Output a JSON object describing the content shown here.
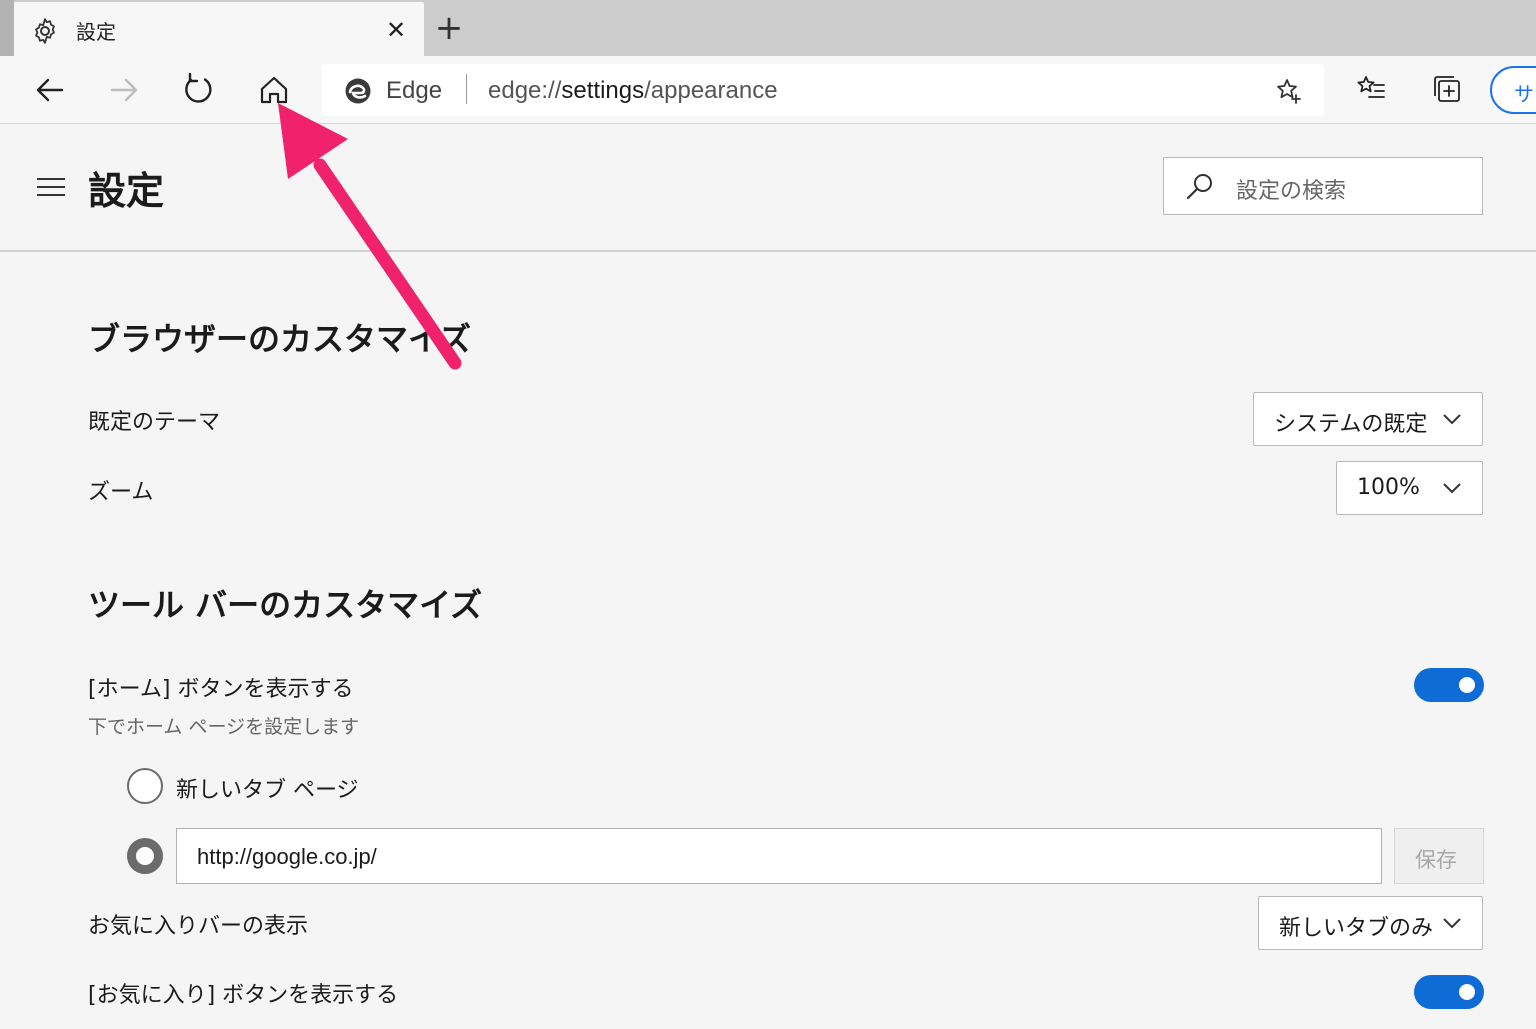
{
  "tab": {
    "title": "設定",
    "close": "✕",
    "new_tab": "+"
  },
  "address_bar": {
    "brand": "Edge",
    "url_scheme": "edge://",
    "url_host": "settings",
    "url_path": "/appearance"
  },
  "profile": {
    "label": "サ"
  },
  "settings": {
    "title": "設定",
    "search_placeholder": "設定の検索",
    "browser_section": {
      "title": "ブラウザーのカスタマイズ",
      "theme_label": "既定のテーマ",
      "theme_value": "システムの既定",
      "zoom_label": "ズーム",
      "zoom_value": "100%"
    },
    "toolbar_section": {
      "title": "ツール バーのカスタマイズ",
      "home_label": "[ホーム] ボタンを表示する",
      "home_sub": "下でホーム ページを設定します",
      "home_enabled": true,
      "option_new_tab": "新しいタブ ページ",
      "home_url": "http://google.co.jp/",
      "save_label": "保存",
      "favbar_label": "お気に入りバーの表示",
      "favbar_value": "新しいタブのみ",
      "fav_button_label": "[お気に入り] ボタンを表示する",
      "fav_button_enabled": true
    }
  },
  "colors": {
    "accent": "#0f6cd6",
    "annotation_arrow": "#f0226c"
  }
}
